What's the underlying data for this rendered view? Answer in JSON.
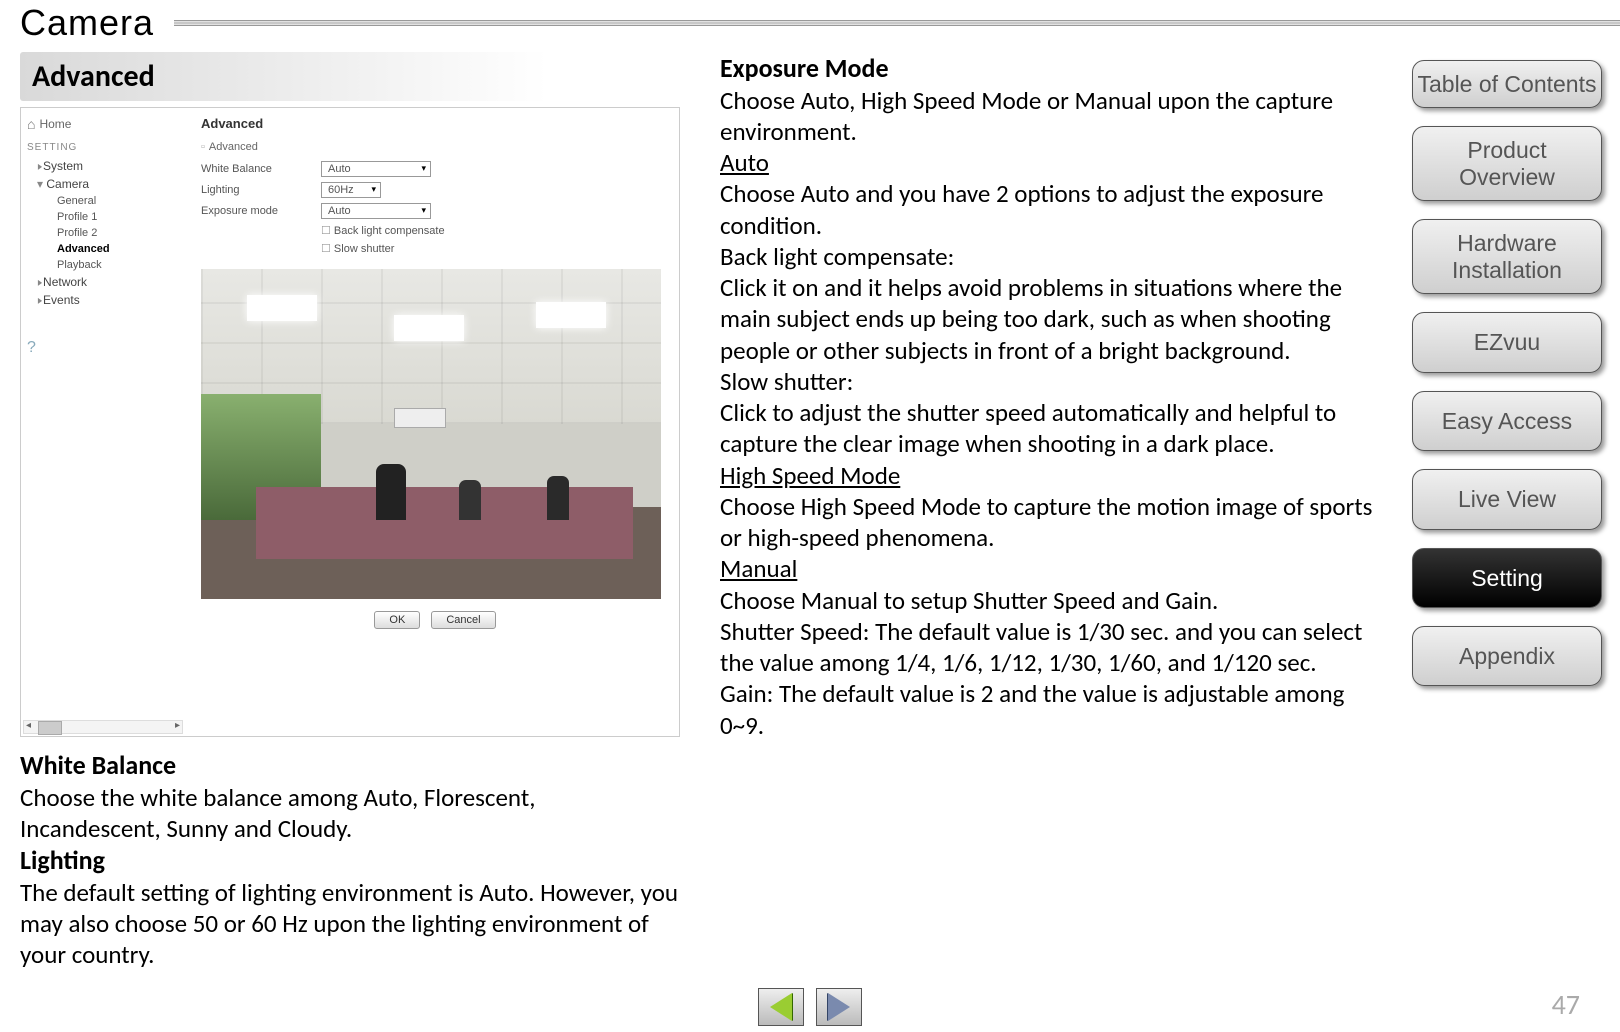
{
  "header": {
    "title": "Camera"
  },
  "section_title": "Advanced",
  "nav": [
    {
      "label": "Table of Contents",
      "active": false,
      "lines": 2
    },
    {
      "label": "Product Overview",
      "active": false,
      "lines": 2
    },
    {
      "label": "Hardware Installation",
      "active": false,
      "lines": 2
    },
    {
      "label": "EZvuu",
      "active": false,
      "lines": 1
    },
    {
      "label": "Easy Access",
      "active": false,
      "lines": 1
    },
    {
      "label": "Live View",
      "active": false,
      "lines": 1
    },
    {
      "label": "Setting",
      "active": true,
      "lines": 1
    },
    {
      "label": "Appendix",
      "active": false,
      "lines": 1
    }
  ],
  "screenshot": {
    "home": "Home",
    "cat": "SETTING",
    "items": {
      "system": "System",
      "camera": "Camera",
      "general": "General",
      "profile1": "Profile 1",
      "profile2": "Profile 2",
      "advanced": "Advanced",
      "playback": "Playback",
      "network": "Network",
      "events": "Events"
    },
    "panel_title": "Advanced",
    "adv_group": "Advanced",
    "rows": {
      "white_balance": {
        "label": "White Balance",
        "value": "Auto"
      },
      "lighting": {
        "label": "Lighting",
        "value": "60Hz"
      },
      "exposure": {
        "label": "Exposure mode",
        "value": "Auto"
      },
      "backlight": "Back light compensate",
      "slowshutter": "Slow shutter"
    },
    "ok": "OK",
    "cancel": "Cancel"
  },
  "left": {
    "wb_h": "White Balance",
    "wb_t": "Choose the white balance among Auto, Florescent, Incandescent, Sunny and Cloudy.",
    "light_h": "Lighting",
    "light_t": "The default setting of lighting environment is Auto. However, you may also choose 50 or 60 Hz upon the lighting environment of your country."
  },
  "right": {
    "exp_h": "Exposure Mode",
    "exp_intro": "Choose Auto, High Speed Mode or Manual upon the capture environment.",
    "auto_h": "Auto",
    "auto_t": "Choose Auto and you have 2 options to adjust the exposure condition.",
    "blc_h": "Back light compensate:",
    "blc_t": "Click it on and it helps avoid problems in situations where the main subject ends up being too dark, such as when shooting people or other subjects in front of a bright background.",
    "ss_h": "Slow shutter:",
    "ss_t": " Click to adjust the shutter speed automatically and helpful to capture the clear image when shooting in a dark place.",
    "hsm_h": "High Speed Mode",
    "hsm_t": "Choose High Speed Mode to capture the motion image of sports or high-speed phenomena.",
    "man_h": "Manual",
    "man_t1": "Choose Manual to setup Shutter Speed and Gain.",
    "man_t2": "Shutter Speed: The default value is 1/30 sec. and you can select the value among 1/4, 1/6, 1/12, 1/30, 1/60, and 1/120 sec.",
    "man_t3": "Gain: The default value is 2 and the value is adjustable among 0~9."
  },
  "page_number": "47"
}
